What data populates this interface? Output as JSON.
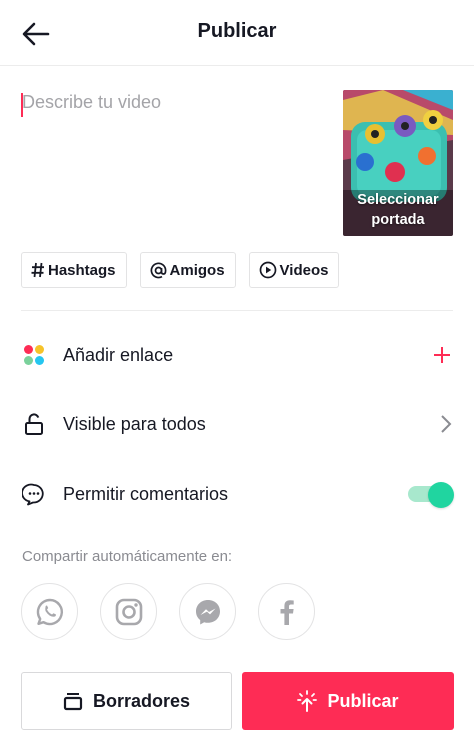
{
  "header": {
    "title": "Publicar",
    "back_icon": "arrow-left-icon"
  },
  "description": {
    "value": "",
    "placeholder": "Describe tu video"
  },
  "cover": {
    "label": "Seleccionar portada"
  },
  "chips": [
    {
      "label": "Hashtags",
      "icon": "hash-icon"
    },
    {
      "label": "Amigos",
      "icon": "at-icon"
    },
    {
      "label": "Videos",
      "icon": "play-circle-icon"
    }
  ],
  "options": {
    "link": {
      "label": "Añadir enlace",
      "icon": "color-dots-icon",
      "action_icon": "plus-icon"
    },
    "visibility": {
      "label": "Visible para todos",
      "icon": "unlock-icon",
      "action_icon": "chevron-right-icon"
    },
    "comments": {
      "label": "Permitir comentarios",
      "icon": "comment-icon",
      "enabled": true
    }
  },
  "share": {
    "label": "Compartir automáticamente en:",
    "targets": [
      "whatsapp-icon",
      "instagram-icon",
      "messenger-icon",
      "facebook-icon"
    ]
  },
  "buttons": {
    "drafts": "Borradores",
    "publish": "Publicar"
  },
  "colors": {
    "accent": "#fe2c55",
    "toggle_on": "#20d5a0",
    "text": "#161823",
    "muted": "#8a8b91"
  }
}
